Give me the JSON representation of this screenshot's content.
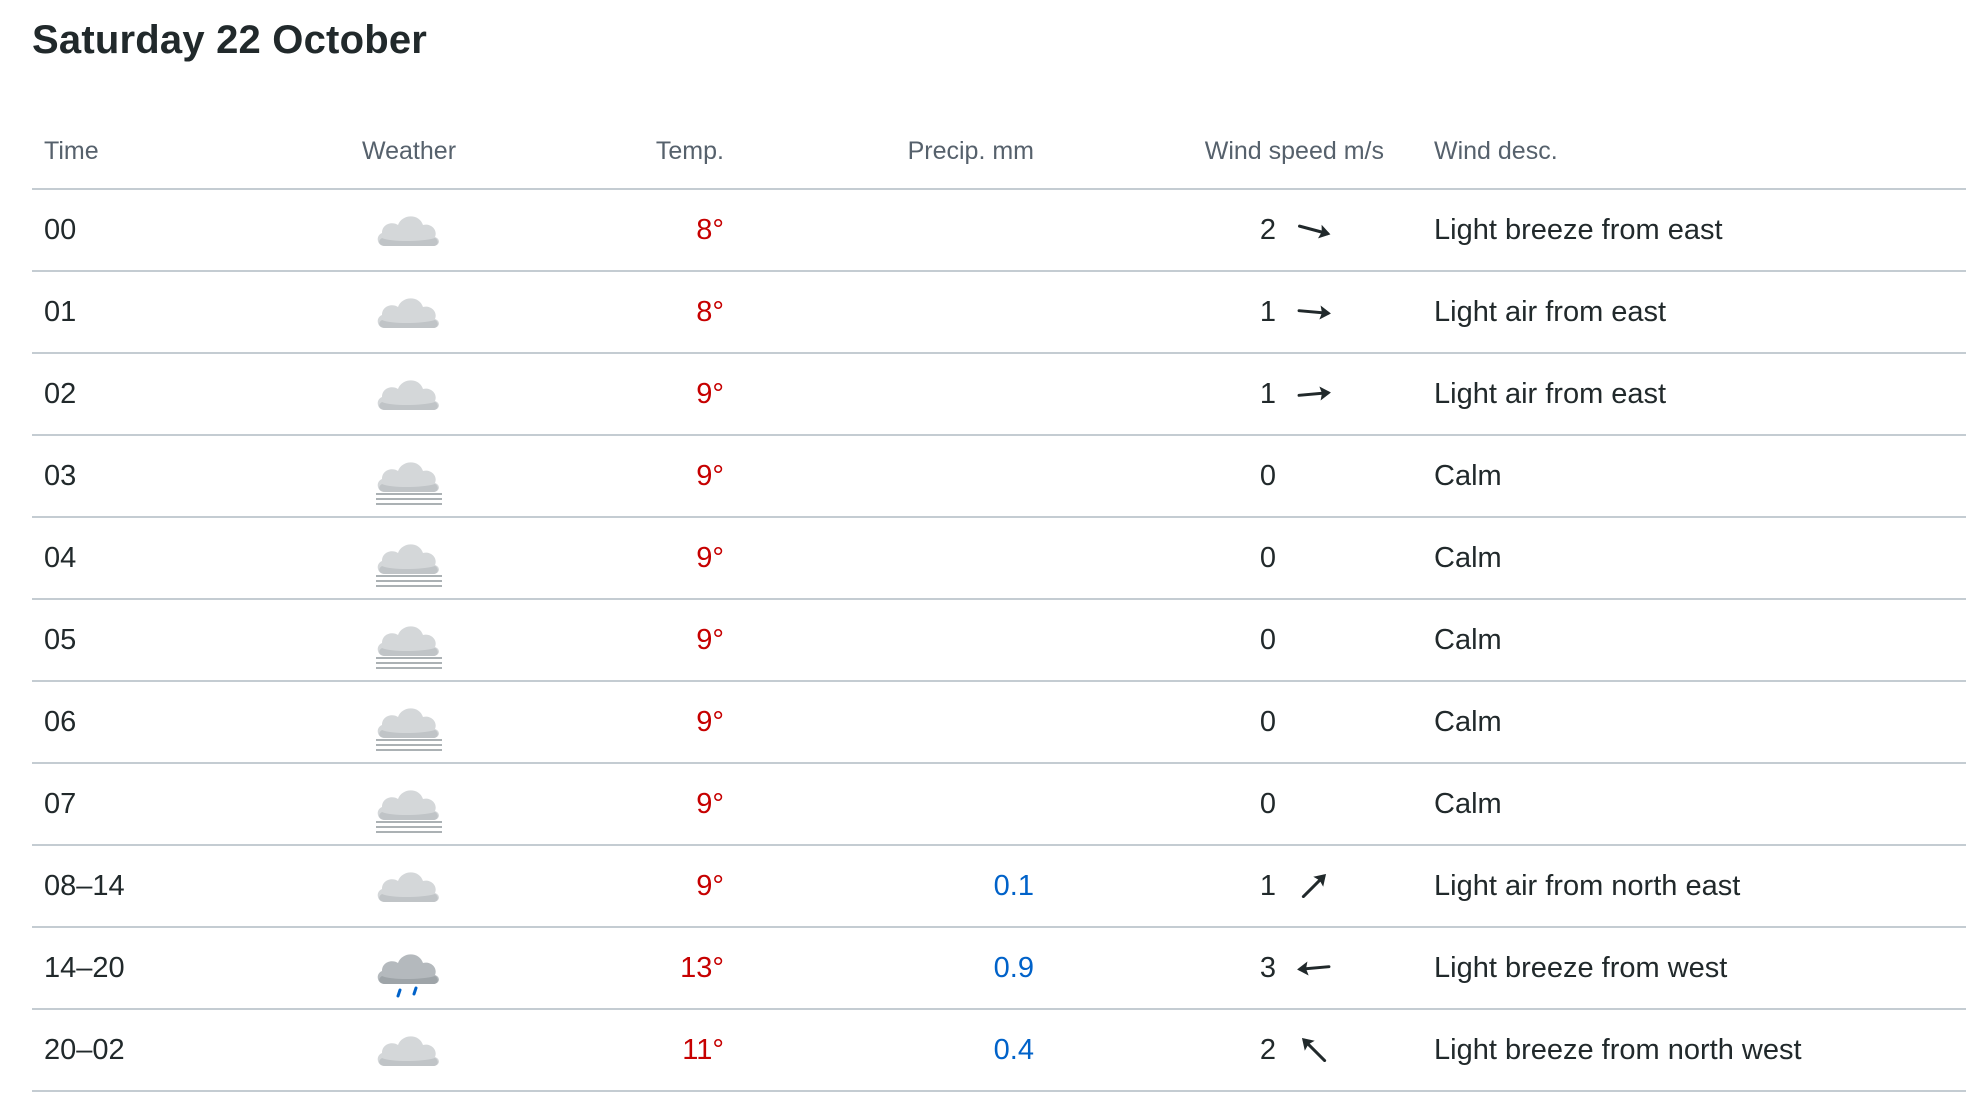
{
  "day": {
    "title": "Saturday 22 October"
  },
  "colors": {
    "temperature": "#c60000",
    "precipitation": "#0062c9",
    "divider": "#c4ccd2",
    "header_text": "#56616c"
  },
  "table": {
    "headers": {
      "time": "Time",
      "weather": "Weather",
      "temp": "Temp.",
      "precip": "Precip. mm",
      "wind_speed": "Wind speed m/s",
      "wind_desc": "Wind desc."
    },
    "rows": [
      {
        "time": "00",
        "weather_icon": "cloudy-icon",
        "temp": "8°",
        "precip": "",
        "wind_speed": "2",
        "wind_arrow": "arrow-from-east-icon",
        "wind_dir_deg": 195,
        "wind_desc": "Light breeze from east"
      },
      {
        "time": "01",
        "weather_icon": "cloudy-icon",
        "temp": "8°",
        "precip": "",
        "wind_speed": "1",
        "wind_arrow": "arrow-from-east-icon",
        "wind_dir_deg": 185,
        "wind_desc": "Light air from east"
      },
      {
        "time": "02",
        "weather_icon": "cloudy-icon",
        "temp": "9°",
        "precip": "",
        "wind_speed": "1",
        "wind_arrow": "arrow-from-east-icon",
        "wind_dir_deg": 175,
        "wind_desc": "Light air from east"
      },
      {
        "time": "03",
        "weather_icon": "fog-icon",
        "temp": "9°",
        "precip": "",
        "wind_speed": "0",
        "wind_arrow": "",
        "wind_dir_deg": null,
        "wind_desc": "Calm"
      },
      {
        "time": "04",
        "weather_icon": "fog-icon",
        "temp": "9°",
        "precip": "",
        "wind_speed": "0",
        "wind_arrow": "",
        "wind_dir_deg": null,
        "wind_desc": "Calm"
      },
      {
        "time": "05",
        "weather_icon": "fog-icon",
        "temp": "9°",
        "precip": "",
        "wind_speed": "0",
        "wind_arrow": "",
        "wind_dir_deg": null,
        "wind_desc": "Calm"
      },
      {
        "time": "06",
        "weather_icon": "fog-icon",
        "temp": "9°",
        "precip": "",
        "wind_speed": "0",
        "wind_arrow": "",
        "wind_dir_deg": null,
        "wind_desc": "Calm"
      },
      {
        "time": "07",
        "weather_icon": "fog-icon",
        "temp": "9°",
        "precip": "",
        "wind_speed": "0",
        "wind_arrow": "",
        "wind_dir_deg": null,
        "wind_desc": "Calm"
      },
      {
        "time": "08–14",
        "weather_icon": "cloudy-icon",
        "temp": "9°",
        "precip": "0.1",
        "wind_speed": "1",
        "wind_arrow": "arrow-from-north-east-icon",
        "wind_dir_deg": 135,
        "wind_desc": "Light air from north east"
      },
      {
        "time": "14–20",
        "weather_icon": "light-rain-icon",
        "temp": "13°",
        "precip": "0.9",
        "wind_speed": "3",
        "wind_arrow": "arrow-from-west-icon",
        "wind_dir_deg": -5,
        "wind_desc": "Light breeze from west"
      },
      {
        "time": "20–02",
        "weather_icon": "cloudy-icon",
        "temp": "11°",
        "precip": "0.4",
        "wind_speed": "2",
        "wind_arrow": "arrow-from-north-west-icon",
        "wind_dir_deg": 45,
        "wind_desc": "Light breeze from north west"
      }
    ]
  }
}
